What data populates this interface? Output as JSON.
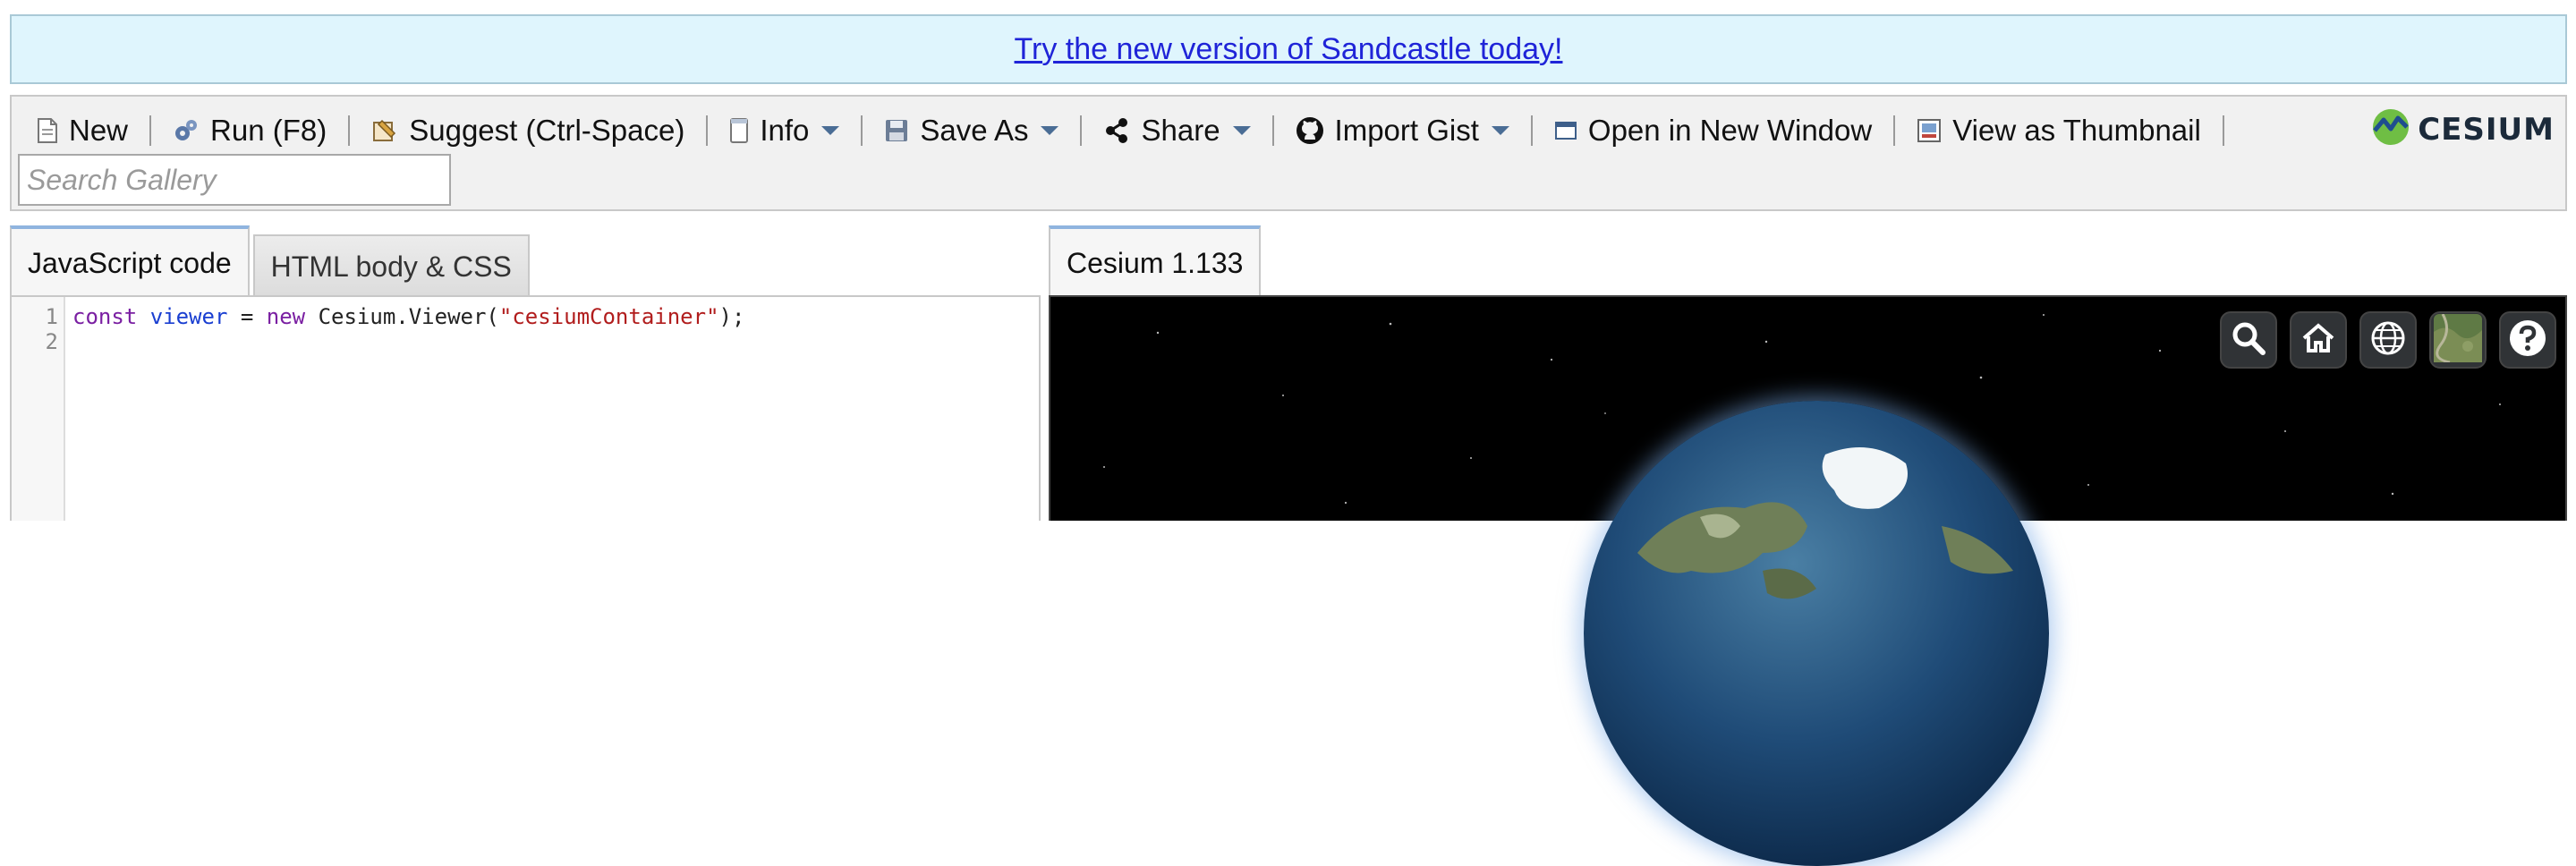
{
  "banner": {
    "link_text": "Try the new version of Sandcastle today!"
  },
  "toolbar": {
    "new_label": "New",
    "run_label": "Run (F8)",
    "suggest_label": "Suggest (Ctrl-Space)",
    "info_label": "Info",
    "save_as_label": "Save As",
    "share_label": "Share",
    "import_gist_label": "Import Gist",
    "open_new_window_label": "Open in New Window",
    "view_thumbnail_label": "View as Thumbnail",
    "logo_text": "CESIUM"
  },
  "search": {
    "placeholder": "Search Gallery",
    "value": ""
  },
  "left_tabs": [
    {
      "label": "JavaScript code",
      "active": true
    },
    {
      "label": "HTML body & CSS",
      "active": false
    }
  ],
  "editor": {
    "line_numbers": [
      "1",
      "2"
    ],
    "code_tokens": {
      "kw_const": "const",
      "var_viewer": "viewer",
      "op_eq": " = ",
      "kw_new": "new",
      "cls": " Cesium.Viewer(",
      "str_arg": "\"cesiumContainer\"",
      "end": ");"
    }
  },
  "right_tabs": [
    {
      "label": "Cesium 1.133",
      "active": true
    }
  ],
  "viewer_toolbar": {
    "icons": [
      "search-icon",
      "home-icon",
      "globe-icon",
      "imagery-layer-icon",
      "help-icon"
    ]
  },
  "colors": {
    "banner_bg": "#dff5fd",
    "link": "#1f24d8",
    "toolbar_bg": "#f1f1f1",
    "tab_active_accent": "#8fb4df",
    "viewer_bg": "#000000"
  }
}
